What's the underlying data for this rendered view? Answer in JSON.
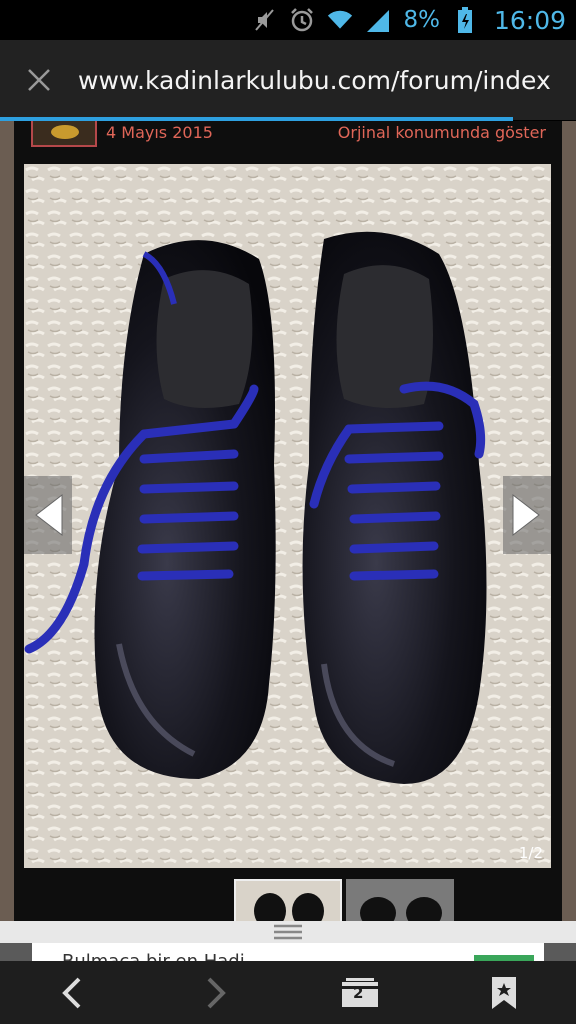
{
  "status_bar": {
    "battery_percent": "8%",
    "time": "16:09",
    "icons": [
      "mute-icon",
      "alarm-icon",
      "wifi-icon",
      "signal-icon",
      "battery-icon"
    ]
  },
  "browser": {
    "url": "www.kadinlarkulubu.com/forum/index",
    "load_progress": 0.89,
    "tab_count": "2"
  },
  "viewer": {
    "date": "4 Mayıs 2015",
    "original_link": "Orjinal konumunda göster",
    "counter": "1/2",
    "thumbnails": [
      {
        "state": "active"
      },
      {
        "state": "inactive"
      }
    ]
  },
  "ad": {
    "text": "Bulmaca bir en Hadi..."
  },
  "colors": {
    "accent": "#2ea0e0",
    "link": "#e06658",
    "laces": "#2a2fb8"
  }
}
